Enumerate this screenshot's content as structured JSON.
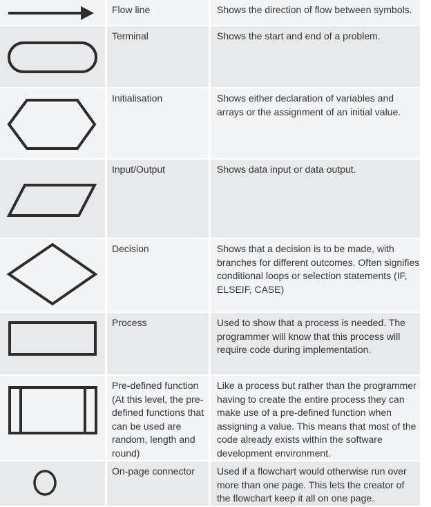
{
  "rows": [
    {
      "symbol": "arrow-icon",
      "name": "Flow line",
      "description": "Shows the direction of flow between symbols."
    },
    {
      "symbol": "terminal-icon",
      "name": "Terminal",
      "description": "Shows the start and end of a problem."
    },
    {
      "symbol": "hexagon-icon",
      "name": "Initialisation",
      "description": "Shows either declaration of variables and arrays or the assignment of an initial value."
    },
    {
      "symbol": "parallelogram-icon",
      "name": "Input/Output",
      "description": "Shows data input or data output."
    },
    {
      "symbol": "diamond-icon",
      "name": "Decision",
      "description": "Shows that a decision is to be made, with branches for different outcomes. Often signifies conditional loops or selection statements (IF, ELSEIF, CASE)"
    },
    {
      "symbol": "rectangle-icon",
      "name": "Process",
      "description": "Used to show that a process is needed. The programmer will know that this process will require code during implementation."
    },
    {
      "symbol": "predefined-process-icon",
      "name": "Pre-defined function (At this level, the pre-defined functions that can be used are random, length and round)",
      "description": "Like a process but rather than the programmer having to create the entire process they can make use of a pre-defined function when assigning a value. This means that most of the code already exists within the software development environment."
    },
    {
      "symbol": "circle-icon",
      "name": "On-page connector",
      "description": "Used if a flowchart would otherwise run over more than one page. This lets the creator of the flowchart keep it all on one page."
    }
  ],
  "colors": {
    "row_light": "#f3f4f6",
    "row_dark": "#e8e9eb",
    "stroke": "#2d2d2d",
    "text": "#333333"
  }
}
